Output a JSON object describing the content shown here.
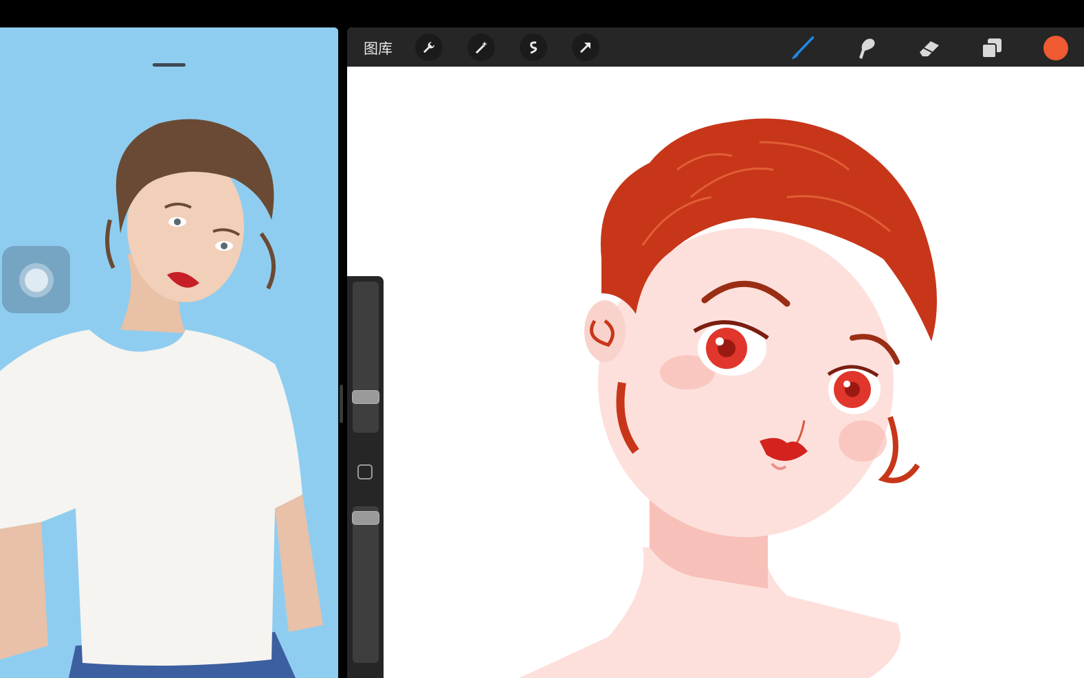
{
  "toolbar": {
    "gallery_label": "图库",
    "left_tools": [
      "wrench-icon",
      "magic-wand-icon",
      "selection-icon",
      "transform-arrow-icon"
    ],
    "right_tools": [
      "brush-icon",
      "smudge-icon",
      "eraser-icon",
      "layers-icon"
    ],
    "active_tool": "brush-icon",
    "accent_color": "#1e88e5",
    "current_color": "#ef5a33"
  },
  "sidebar": {
    "brush_size_level": 0.3,
    "opacity_level": 0.9
  },
  "reference_panel": {
    "background_color": "#8fcdf0"
  },
  "colors": {
    "hair": "#c8361a",
    "skin": "#fde0dc",
    "lips": "#d4221e",
    "eyes": "#e0362c"
  }
}
